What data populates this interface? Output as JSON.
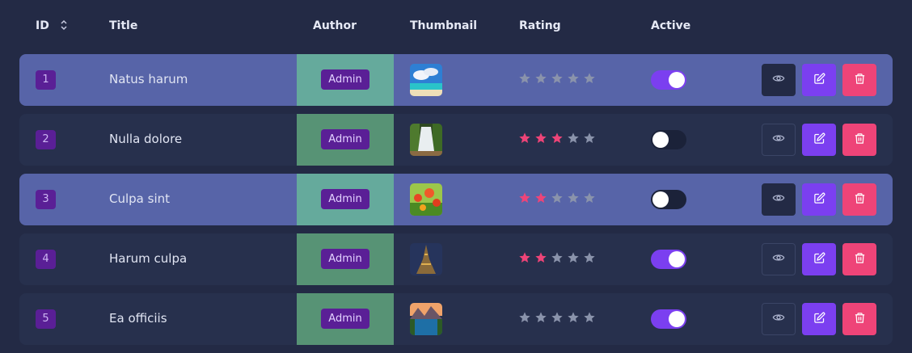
{
  "table": {
    "headers": {
      "id": "ID",
      "title": "Title",
      "author": "Author",
      "thumbnail": "Thumbnail",
      "rating": "Rating",
      "active": "Active"
    },
    "rows": [
      {
        "id": "1",
        "title": "Natus harum",
        "author": "Admin",
        "thumbnail": "beach-thumbnail",
        "rating": 0,
        "active": true,
        "highlighted": true
      },
      {
        "id": "2",
        "title": "Nulla dolore",
        "author": "Admin",
        "thumbnail": "waterfall-thumbnail",
        "rating": 3,
        "active": false,
        "highlighted": false
      },
      {
        "id": "3",
        "title": "Culpa sint",
        "author": "Admin",
        "thumbnail": "flowers-thumbnail",
        "rating": 2,
        "active": false,
        "highlighted": true
      },
      {
        "id": "4",
        "title": "Harum culpa",
        "author": "Admin",
        "thumbnail": "tower-thumbnail",
        "rating": 2,
        "active": true,
        "highlighted": false
      },
      {
        "id": "5",
        "title": "Ea officiis",
        "author": "Admin",
        "thumbnail": "mountain-lake-thumbnail",
        "rating": 0,
        "active": true,
        "highlighted": false
      }
    ],
    "rating_max": 5,
    "icons": {
      "sort": "sort-icon",
      "view": "eye-icon",
      "edit": "pencil-icon",
      "delete": "trash-icon",
      "star": "star-icon"
    }
  },
  "colors": {
    "background": "#232a45",
    "row": "#27304d",
    "row_highlight": "#5764a8",
    "accent": "#7b3ff0",
    "danger": "#ee4478",
    "star_filled": "#ee4478",
    "star_empty": "#8a93ab",
    "badge": "#5a1f96"
  }
}
